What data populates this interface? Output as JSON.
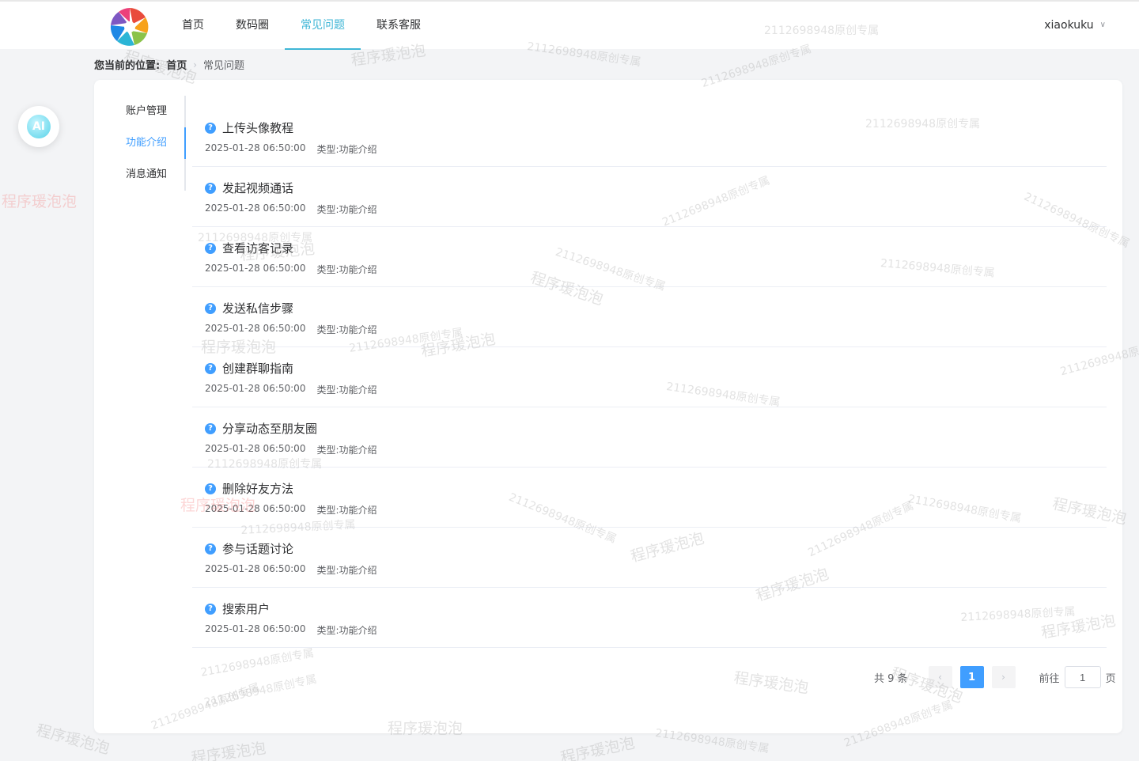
{
  "header": {
    "nav": [
      "首页",
      "数码圈",
      "常见问题",
      "联系客服"
    ],
    "active_nav": 2,
    "username": "xiaokuku",
    "user_chevron_icon": "chevron-down-icon"
  },
  "breadcrumb": {
    "label": "您当前的位置:",
    "home": "首页",
    "current": "常见问题"
  },
  "ai_button": {
    "label": "AI"
  },
  "sidebar": {
    "items": [
      "账户管理",
      "功能介绍",
      "消息通知"
    ],
    "active": 1
  },
  "faq": {
    "type_label": "类型:",
    "items": [
      {
        "title": "上传头像教程",
        "time": "2025-01-28 06:50:00",
        "type": "功能介绍"
      },
      {
        "title": "发起视频通话",
        "time": "2025-01-28 06:50:00",
        "type": "功能介绍"
      },
      {
        "title": "查看访客记录",
        "time": "2025-01-28 06:50:00",
        "type": "功能介绍"
      },
      {
        "title": "发送私信步骤",
        "time": "2025-01-28 06:50:00",
        "type": "功能介绍"
      },
      {
        "title": "创建群聊指南",
        "time": "2025-01-28 06:50:00",
        "type": "功能介绍"
      },
      {
        "title": "分享动态至朋友圈",
        "time": "2025-01-28 06:50:00",
        "type": "功能介绍"
      },
      {
        "title": "删除好友方法",
        "time": "2025-01-28 06:50:00",
        "type": "功能介绍"
      },
      {
        "title": "参与话题讨论",
        "time": "2025-01-28 06:50:00",
        "type": "功能介绍"
      },
      {
        "title": "搜索用户",
        "time": "2025-01-28 06:50:00",
        "type": "功能介绍"
      }
    ]
  },
  "pagination": {
    "total": "共 9 条",
    "current_page": "1",
    "goto_label": "前往",
    "goto_value": "1",
    "page_suffix": "页"
  },
  "watermarks": {
    "id_text": "2112698948原创专属",
    "brand_text": "程序瑗泡泡"
  }
}
